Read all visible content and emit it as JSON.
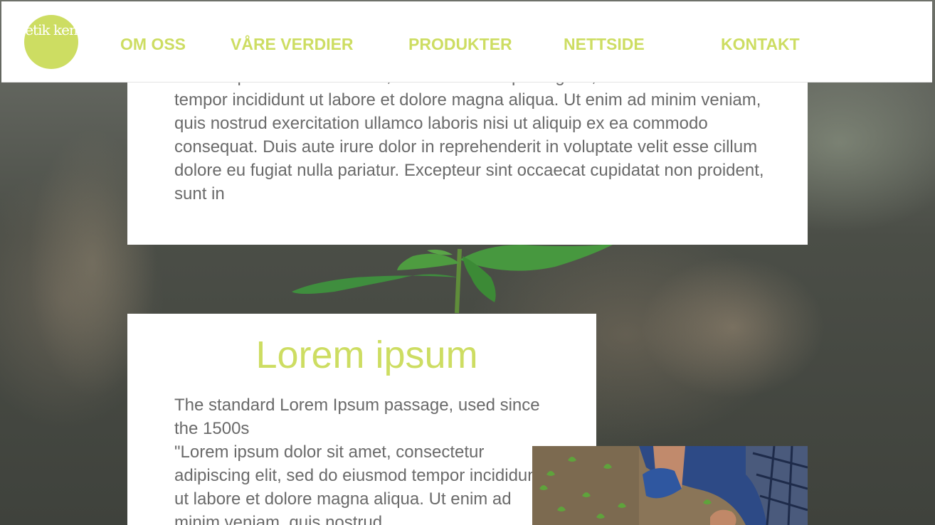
{
  "logo": {
    "text": "etik ken"
  },
  "nav": {
    "items": [
      {
        "label": "OM OSS"
      },
      {
        "label": "VÅRE VERDIER"
      },
      {
        "label": "PRODUKTER"
      },
      {
        "label": "NETTSIDE"
      },
      {
        "label": "KONTAKT"
      }
    ]
  },
  "section1": {
    "body": "\"Lorem ipsum dolor sit amet, consectetur adipiscing elit, sed do eiusmod tempor incididunt ut labore et dolore magna aliqua. Ut enim ad minim veniam, quis nostrud exercitation ullamco laboris nisi ut aliquip ex ea commodo consequat. Duis aute irure dolor in reprehenderit in voluptate velit esse cillum dolore eu fugiat nulla pariatur. Excepteur sint occaecat cupidatat non proident, sunt in"
  },
  "section2": {
    "title": "Lorem ipsum",
    "subtitle": "The standard Lorem Ipsum passage, used since the 1500s",
    "body": "\"Lorem ipsum dolor sit amet, consectetur adipiscing elit, sed do eiusmod tempor incididunt ut labore et dolore magna aliqua. Ut enim ad minim veniam, quis nostrud"
  },
  "colors": {
    "accent": "#cddd62",
    "text": "#6a6a6a",
    "header_bg": "#ffffff"
  }
}
